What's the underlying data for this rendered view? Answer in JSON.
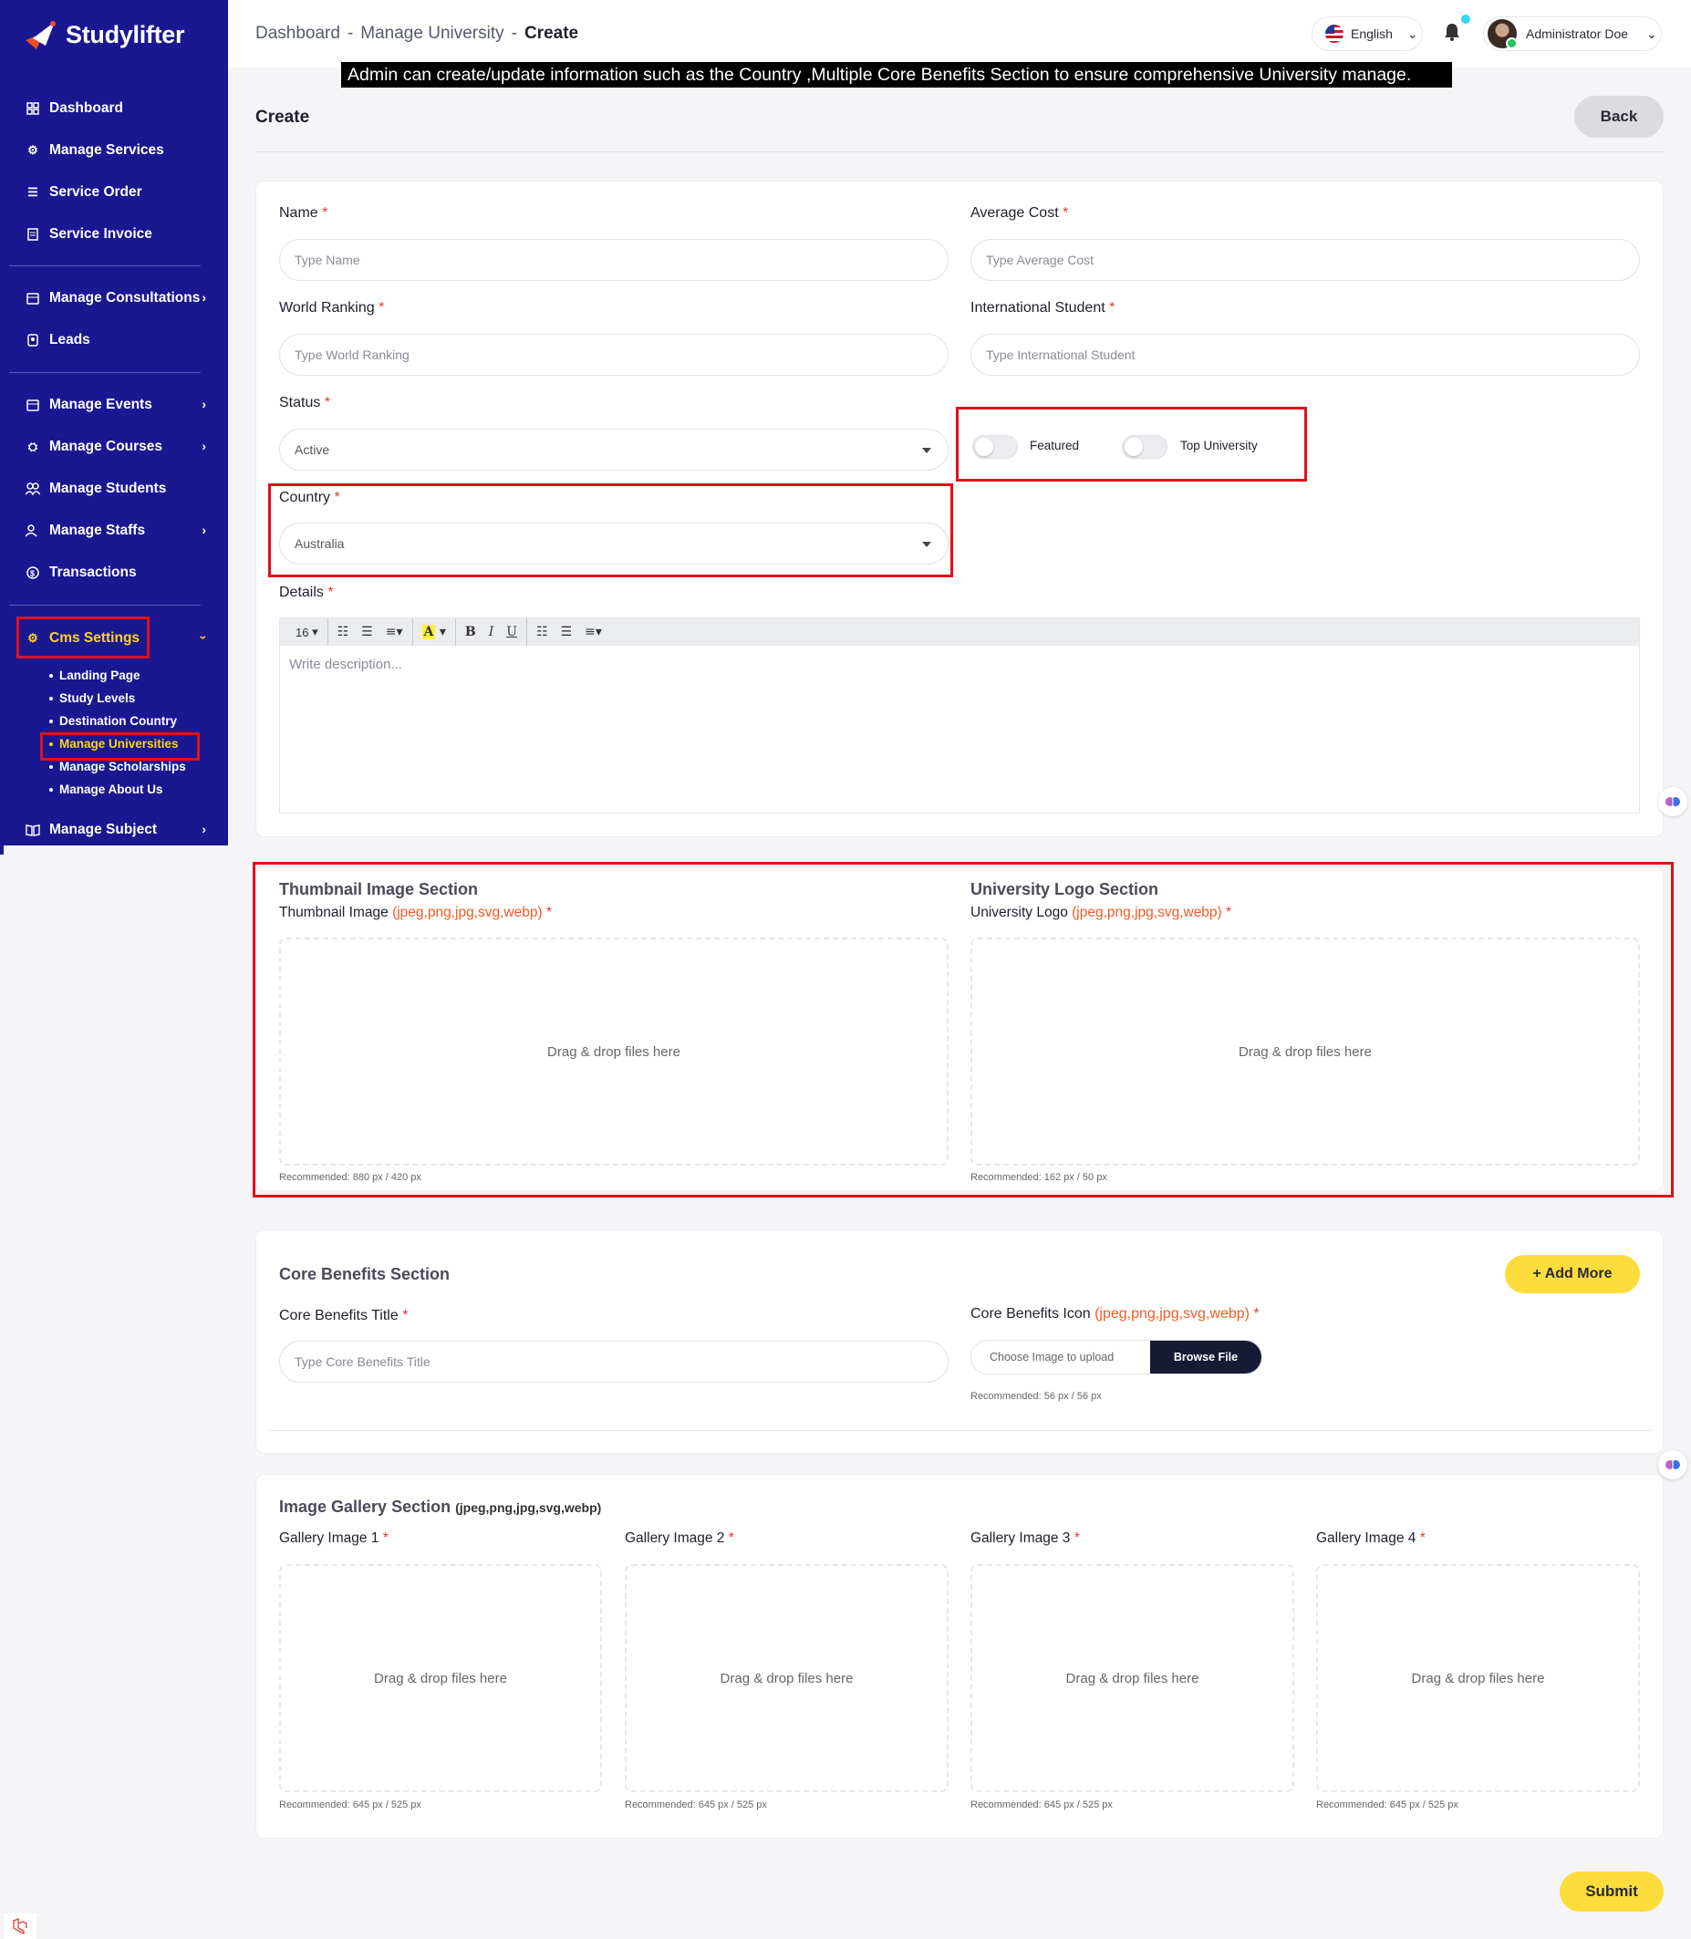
{
  "app": {
    "name": "Studylifter"
  },
  "sidebar": {
    "items": [
      {
        "label": "Dashboard"
      },
      {
        "label": "Manage Services"
      },
      {
        "label": "Service Order"
      },
      {
        "label": "Service Invoice"
      },
      {
        "label": "Manage Consultations"
      },
      {
        "label": "Leads"
      },
      {
        "label": "Manage Events"
      },
      {
        "label": "Manage Courses"
      },
      {
        "label": "Manage Students"
      },
      {
        "label": "Manage Staffs"
      },
      {
        "label": "Transactions"
      },
      {
        "label": "Cms Settings"
      },
      {
        "label": "Manage Subject"
      }
    ],
    "cms_sub": [
      {
        "label": "Landing Page"
      },
      {
        "label": "Study Levels"
      },
      {
        "label": "Destination Country"
      },
      {
        "label": "Manage Universities"
      },
      {
        "label": "Manage Scholarships"
      },
      {
        "label": "Manage About Us"
      }
    ]
  },
  "topbar": {
    "breadcrumb": [
      "Dashboard",
      "-",
      "Manage University",
      "-",
      "Create"
    ],
    "language": "English",
    "user_name": "Administrator Doe"
  },
  "banner": "Admin can create/update information such as the Country ,Multiple Core Benefits Section to ensure comprehensive University manage.",
  "page": {
    "title": "Create",
    "back_label": "Back",
    "submit_label": "Submit"
  },
  "form": {
    "name": {
      "label": "Name",
      "placeholder": "Type Name"
    },
    "average_cost": {
      "label": "Average Cost",
      "placeholder": "Type Average Cost"
    },
    "world_ranking": {
      "label": "World Ranking",
      "placeholder": "Type World Ranking"
    },
    "international_student": {
      "label": "International Student",
      "placeholder": "Type International Student"
    },
    "status": {
      "label": "Status",
      "value": "Active"
    },
    "featured_label": "Featured",
    "top_university_label": "Top University",
    "country": {
      "label": "Country",
      "value": "Australia"
    },
    "details": {
      "label": "Details",
      "font_size": "16",
      "placeholder": "Write description..."
    }
  },
  "media": {
    "thumbnail": {
      "section_title": "Thumbnail Image Section",
      "label": "Thumbnail Image",
      "formats": "(jpeg,png,jpg,svg,webp)",
      "drop_text": "Drag & drop files here",
      "recommended": "Recommended: 880 px / 420 px"
    },
    "logo": {
      "section_title": "University Logo Section",
      "label": "University Logo",
      "formats": "(jpeg,png,jpg,svg,webp)",
      "drop_text": "Drag & drop files here",
      "recommended": "Recommended: 162 px / 50 px"
    }
  },
  "core_benefits": {
    "section_title": "Core Benefits Section",
    "add_more_label": "+ Add More",
    "title_label": "Core Benefits Title",
    "title_placeholder": "Type Core Benefits Title",
    "icon_label": "Core Benefits Icon",
    "icon_formats": "(jpeg,png,jpg,svg,webp)",
    "file_placeholder": "Choose Image to upload",
    "browse_label": "Browse File",
    "recommended": "Recommended: 56 px / 56 px"
  },
  "gallery": {
    "section_title": "Image Gallery Section",
    "formats": "(jpeg,png,jpg,svg,webp)",
    "items": [
      {
        "label": "Gallery Image 1",
        "drop_text": "Drag & drop files here",
        "recommended": "Recommended: 645 px / 525 px"
      },
      {
        "label": "Gallery Image 2",
        "drop_text": "Drag & drop files here",
        "recommended": "Recommended: 645 px / 525 px"
      },
      {
        "label": "Gallery Image 3",
        "drop_text": "Drag & drop files here",
        "recommended": "Recommended: 645 px / 525 px"
      },
      {
        "label": "Gallery Image 4",
        "drop_text": "Drag & drop files here",
        "recommended": "Recommended: 645 px / 525 px"
      }
    ]
  },
  "required_mark": "*",
  "colors": {
    "sidebar": "#1a1891",
    "accent_yellow": "#fcdd3b",
    "active_text": "#ffd21f",
    "highlight_red": "#e0101b",
    "format_orange": "#f05a22"
  }
}
